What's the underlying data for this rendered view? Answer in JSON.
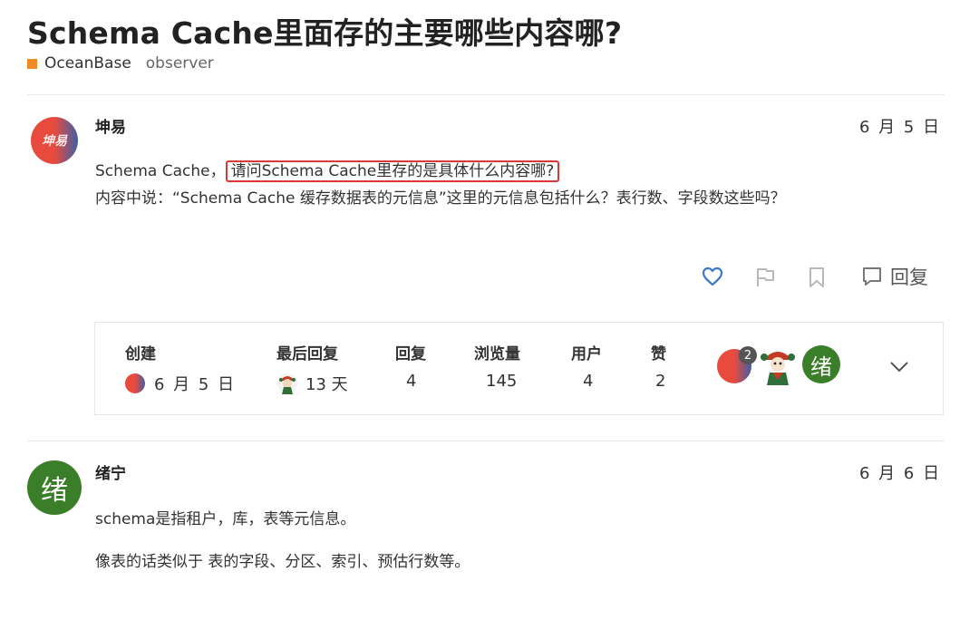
{
  "topic": {
    "title": "Schema Cache里面存的主要哪些内容哪?",
    "category": "OceanBase",
    "tag": "observer",
    "category_color": "#f08a24"
  },
  "posts": [
    {
      "author": "坤易",
      "avatar_text": "坤易",
      "date": "6 月 5 日",
      "line1_prefix": "Schema Cache，",
      "line1_highlight": "请问Schema Cache里存的是具体什么内容哪?",
      "line2": "内容中说：“Schema Cache 缓存数据表的元信息”这里的元信息包括什么？表行数、字段数这些吗？"
    },
    {
      "author": "绪宁",
      "avatar_text": "绪",
      "date": "6 月 6 日",
      "paragraph1": "schema是指租户，库，表等元信息。",
      "paragraph2": "像表的话类似于 表的字段、分区、索引、预估行数等。"
    }
  ],
  "actions": {
    "like_icon": "heart-icon",
    "flag_icon": "flag-icon",
    "bookmark_icon": "bookmark-icon",
    "reply_icon": "reply-icon",
    "reply_label": "回复",
    "like_color": "#3c78c8"
  },
  "summary": {
    "created_label": "创建",
    "created_value": "6 月 5 日",
    "last_reply_label": "最后回复",
    "last_reply_value": "13 天",
    "replies_label": "回复",
    "replies_value": "4",
    "views_label": "浏览量",
    "views_value": "145",
    "users_label": "用户",
    "users_value": "4",
    "likes_label": "赞",
    "likes_value": "2",
    "participant_badge": "2",
    "participant_avatar_text": "绪",
    "expand_icon": "chevron-down-icon"
  }
}
